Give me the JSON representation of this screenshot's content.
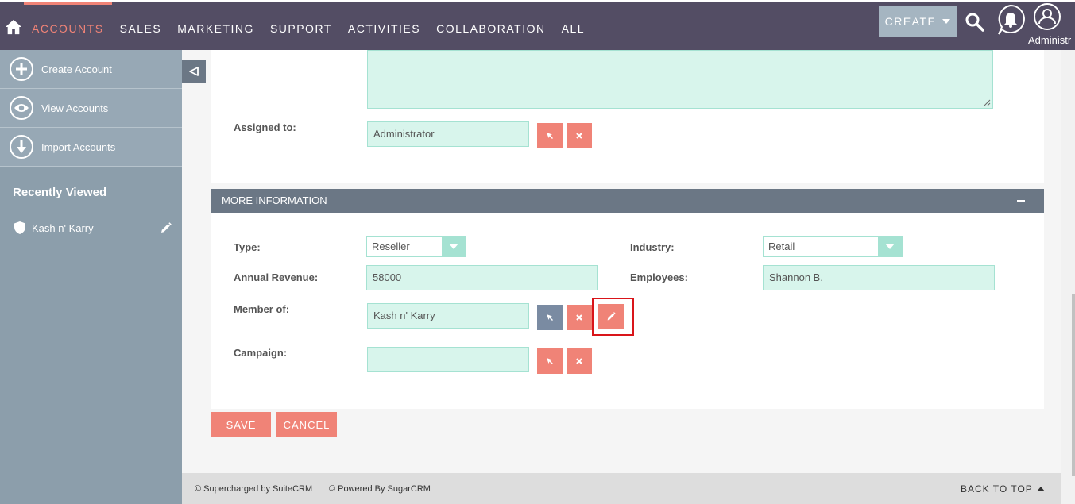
{
  "nav": {
    "tabs": [
      "ACCOUNTS",
      "SALES",
      "MARKETING",
      "SUPPORT",
      "ACTIVITIES",
      "COLLABORATION",
      "ALL"
    ],
    "active_tab": "ACCOUNTS",
    "create_label": "CREATE",
    "user_label": "Administr"
  },
  "sidebar": {
    "actions": [
      {
        "label": "Create Account",
        "icon": "plus-icon"
      },
      {
        "label": "View Accounts",
        "icon": "eye-icon"
      },
      {
        "label": "Import Accounts",
        "icon": "download-icon"
      }
    ],
    "recent_title": "Recently Viewed",
    "recent_items": [
      {
        "label": "Kash n' Karry",
        "icon": "shield-icon"
      }
    ]
  },
  "form": {
    "assigned_to_label": "Assigned to:",
    "assigned_to_value": "Administrator",
    "section_title": "MORE INFORMATION",
    "type_label": "Type:",
    "type_value": "Reseller",
    "industry_label": "Industry:",
    "industry_value": "Retail",
    "annual_revenue_label": "Annual Revenue:",
    "annual_revenue_value": "58000",
    "employees_label": "Employees:",
    "employees_value": "Shannon B.",
    "member_of_label": "Member of:",
    "member_of_value": "Kash n' Karry",
    "campaign_label": "Campaign:",
    "campaign_value": "",
    "save_label": "SAVE",
    "cancel_label": "CANCEL"
  },
  "footer": {
    "supercharged": "© Supercharged by SuiteCRM",
    "powered": "© Powered By SugarCRM",
    "back_to_top": "BACK TO TOP"
  },
  "colors": {
    "nav_bg": "#534d64",
    "accent": "#f08377",
    "field_bg": "#d8f5ec",
    "sidebar_bg": "#8c9eab",
    "highlight": "#d9151a"
  }
}
